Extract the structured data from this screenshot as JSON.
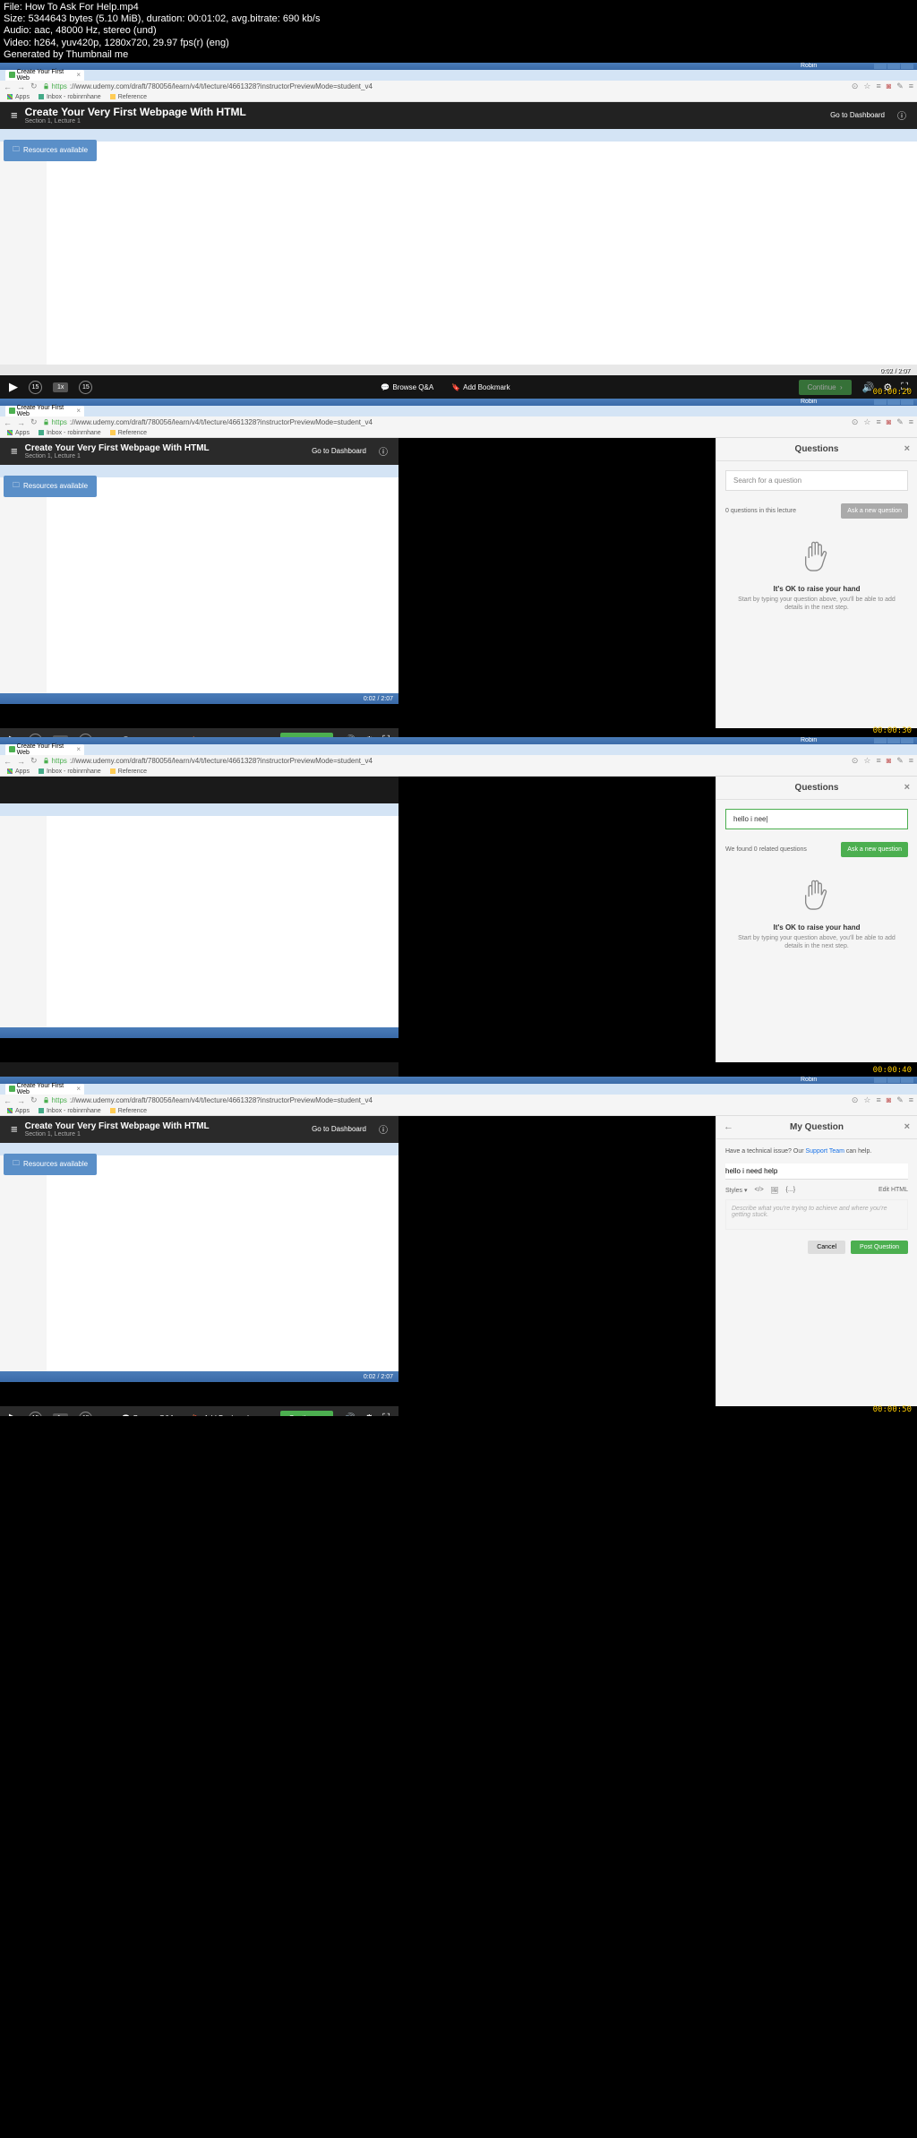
{
  "meta": {
    "file": "File: How To Ask For Help.mp4",
    "size": "Size: 5344643 bytes (5.10 MiB), duration: 00:01:02, avg.bitrate: 690 kb/s",
    "audio": "Audio: aac, 48000 Hz, stereo (und)",
    "video": "Video: h264, yuv420p, 1280x720, 29.97 fps(r) (eng)",
    "gen": "Generated by Thumbnail me"
  },
  "win": {
    "user": "Robin"
  },
  "browser": {
    "tab_title": "Create Your First Web",
    "url_https": "https",
    "url_rest": "://www.udemy.com/draft/780056/learn/v4/t/lecture/4661328?instructorPreviewMode=student_v4",
    "bm_apps": "Apps",
    "bm_inbox": "Inbox - robinrnhane",
    "bm_ref": "Reference"
  },
  "course": {
    "title": "Create Your Very First Webpage With HTML",
    "sub": "Section 1, Lecture 1",
    "dashboard": "Go to Dashboard",
    "resources": "Resources available"
  },
  "controls": {
    "speed": "1x",
    "skip_back": "15",
    "skip_fwd": "15",
    "browse_qa": "Browse Q&A",
    "add_bookmark": "Add Bookmark",
    "continue": "Continue",
    "time1": "0:02  /  2:07",
    "time2": "0:02  /  2:07"
  },
  "frame_ts": {
    "f1": "00:00:20",
    "f2": "00:00:30",
    "f3": "00:00:40",
    "f4": "00:00:50"
  },
  "sidebar2": {
    "title": "Questions",
    "placeholder": "Search for a question",
    "count": "0 questions in this lecture",
    "ask": "Ask a new question",
    "raise_title": "It's OK to raise your hand",
    "raise_sub": "Start by typing your question above, you'll be able to add details in the next step."
  },
  "sidebar3": {
    "title": "Questions",
    "input_value": "hello i nee",
    "found": "We found 0 related questions",
    "ask": "Ask a new question",
    "raise_title": "It's OK to raise your hand",
    "raise_sub": "Start by typing your question above, you'll be able to add details in the next step."
  },
  "sidebar4": {
    "title": "My Question",
    "tech_pre": "Have a technical issue? Our ",
    "tech_link": "Support Team",
    "tech_post": " can help.",
    "q_title": "hello i need help",
    "styles": "Styles",
    "edit_html": "Edit HTML",
    "body_placeholder": "Describe what you're trying to achieve and where you're getting stuck.",
    "cancel": "Cancel",
    "post": "Post Question"
  }
}
